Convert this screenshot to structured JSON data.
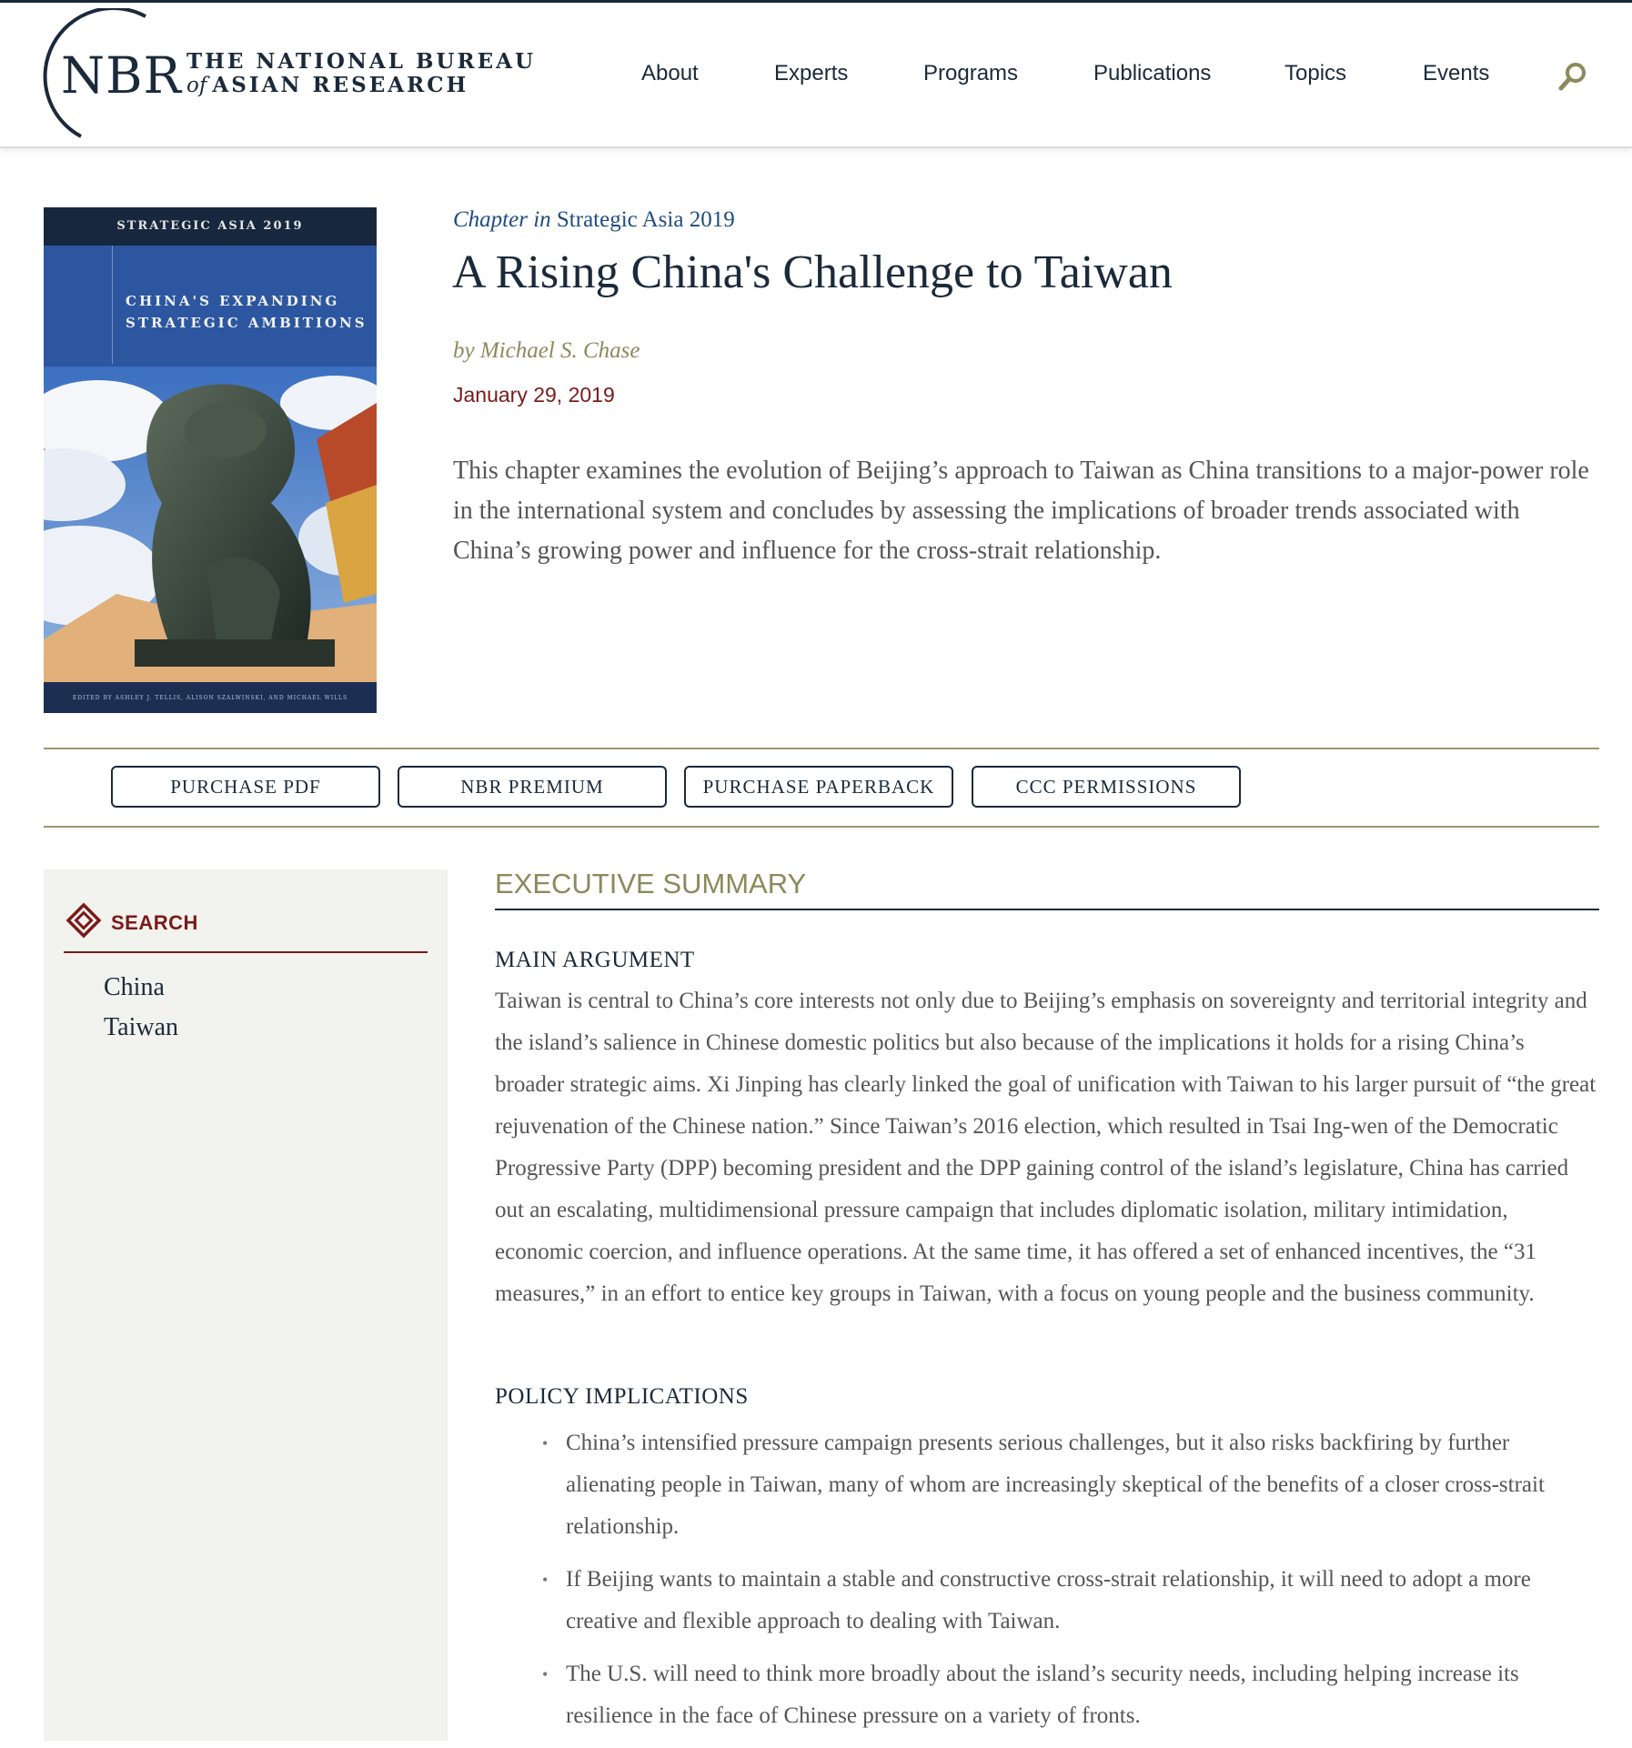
{
  "header": {
    "logo": {
      "abbr": "NBR",
      "line1": "THE NATIONAL BUREAU",
      "line2_of": "of",
      "line2": "ASIAN RESEARCH"
    },
    "nav": [
      "About",
      "Experts",
      "Programs",
      "Publications",
      "Topics",
      "Events"
    ],
    "search_icon": "search-icon"
  },
  "cover": {
    "series": "STRATEGIC ASIA 2019",
    "title_line1": "CHINA'S EXPANDING",
    "title_line2": "STRATEGIC AMBITIONS",
    "editors": "EDITED BY ASHLEY J. TELLIS, ALISON SZALWINSKI, AND MICHAEL WILLS"
  },
  "article": {
    "chapter_prefix": "Chapter in",
    "book": "Strategic Asia 2019",
    "title": "A Rising China's Challenge to Taiwan",
    "byline": "by Michael S. Chase",
    "date": "January 29, 2019",
    "abstract": "This chapter examines the evolution of Beijing’s approach to Taiwan as China transitions to a major-power role in the international system and concludes by assessing the implications of broader trends associated with China’s growing power and influence for the cross-strait relationship."
  },
  "actions": [
    "PURCHASE PDF",
    "NBR PREMIUM",
    "PURCHASE PAPERBACK",
    "CCC PERMISSIONS"
  ],
  "sidebar": {
    "heading": "SEARCH",
    "tags": [
      "China",
      "Taiwan"
    ]
  },
  "summary": {
    "heading": "EXECUTIVE SUMMARY",
    "main_argument_heading": "MAIN ARGUMENT",
    "main_argument": "Taiwan is central to China’s core interests not only due to Beijing’s emphasis on sovereignty and territorial integrity and the island’s salience in Chinese domestic politics but also because of the implications it holds for a rising China’s broader strategic aims. Xi Jinping has clearly linked the goal of unification with Taiwan to his larger pursuit of “the great rejuvenation of the Chinese nation.” Since Taiwan’s 2016 election, which resulted in Tsai Ing-wen of the Democratic Progressive Party (DPP) becoming president and the DPP gaining control of the island’s legislature, China has carried out an escalating, multidimensional pressure campaign that includes diplomatic isolation, military intimidation, economic coercion, and influence operations. At the same time, it has offered a set of enhanced incentives, the “31 measures,” in an effort to entice key groups in Taiwan, with a focus on young people and the business community.",
    "policy_heading": "POLICY IMPLICATIONS",
    "policy": [
      "China’s intensified pressure campaign presents serious challenges, but it also risks backfiring by further alienating people in Taiwan, many of whom are increasingly skeptical of the benefits of a closer cross-strait relationship.",
      "If Beijing wants to maintain a stable and constructive cross-strait relationship, it will need to adopt a more creative and flexible approach to dealing with Taiwan.",
      "The U.S. will need to think more broadly about the island’s security needs, including helping increase its resilience in the face of Chinese pressure on a variety of fronts."
    ]
  },
  "colors": {
    "navy": "#1b2a3a",
    "olive": "#8a8a5c",
    "maroon": "#7a1a1a",
    "link_blue": "#1f4c80",
    "body_gray": "#555555",
    "sidebar_bg": "#f2f2ee"
  }
}
